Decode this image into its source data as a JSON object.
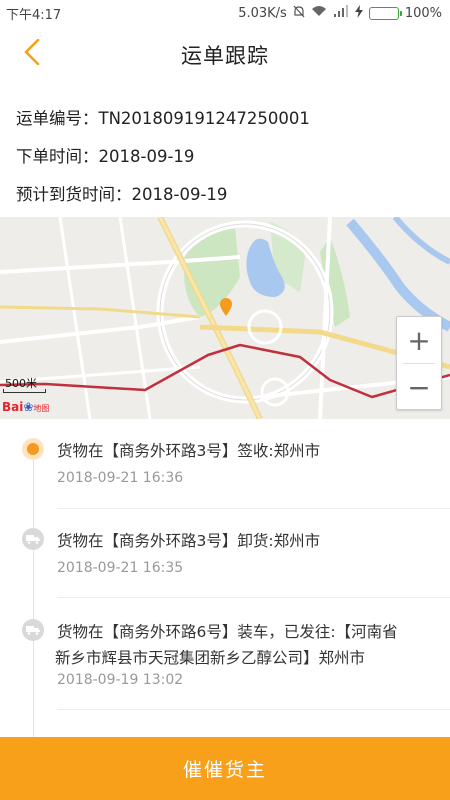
{
  "status_bar": {
    "time": "下午4:17",
    "network_speed": "5.03K/s",
    "battery": "100%",
    "icons": [
      "mute-icon",
      "wifi-icon",
      "signal-icon",
      "charging-icon",
      "battery-icon"
    ]
  },
  "header": {
    "title": "运单跟踪",
    "back_icon": "chevron-left-icon",
    "accent_color": "#f8a01a"
  },
  "order_info": {
    "waybill_no": "运单编号：TN201809191247250001",
    "order_time": "下单时间：2018-09-19",
    "expected_arrival": "预计到货时间：2018-09-19"
  },
  "map": {
    "scale_label": "500米",
    "logo": {
      "bai": "Bai",
      "ditu": "地图"
    },
    "zoom_in": "+",
    "zoom_out": "−",
    "route_color": "#c0303f",
    "marker_color": "#f49a1c"
  },
  "timeline": [
    {
      "text": "货物在【商务外环路3号】签收:郑州市",
      "time": "2018-09-21 16:36",
      "status": "current"
    },
    {
      "text": "货物在【商务外环路3号】卸货:郑州市",
      "time": "2018-09-21 16:35",
      "status": "past"
    },
    {
      "text_line1": "货物在【商务外环路6号】装车，已发往:【河南省",
      "text_line2": "新乡市辉县市天冠集团新乡乙醇公司】郑州市",
      "time": "2018-09-19 13:02",
      "status": "past"
    }
  ],
  "bottom_button": {
    "label": "催催货主",
    "color": "#f8a01a"
  }
}
